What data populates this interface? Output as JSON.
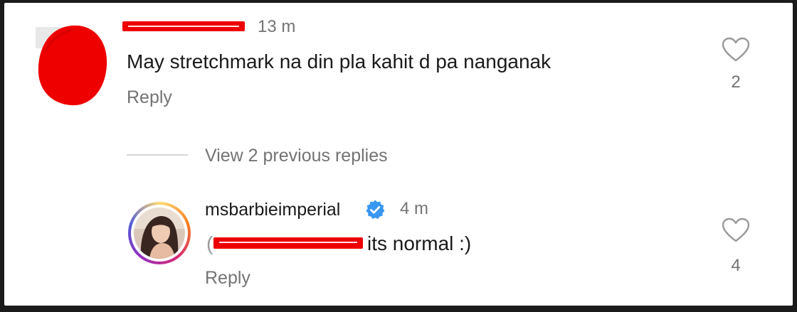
{
  "comments": [
    {
      "time": "13 m",
      "text": "May stretchmark na din pla kahit d pa nanganak",
      "reply_label": "Reply",
      "likes": "2",
      "heart_icon": "heart-outline-icon"
    },
    {
      "username": "msbarbieimperial",
      "verified": true,
      "time": "4 m",
      "mention_prefix": "(",
      "text": "its normal :)",
      "reply_label": "Reply",
      "likes": "4",
      "heart_icon": "heart-outline-icon"
    }
  ],
  "thread": {
    "view_replies_label": "View 2 previous replies"
  },
  "colors": {
    "redaction": "#ee0000",
    "secondary_text": "#737373",
    "primary_text": "#1a1a1a",
    "verified_blue": "#3897f0",
    "divider": "#d6d6d6"
  }
}
